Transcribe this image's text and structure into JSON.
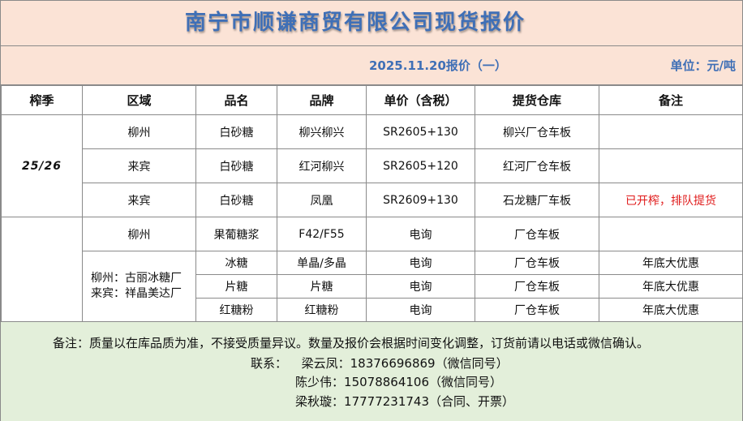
{
  "header": {
    "title": "南宁市顺谦商贸有限公司现货报价",
    "date_label": "2025.11.20报价（一）",
    "unit_label": "单位：元/吨"
  },
  "table": {
    "columns": [
      "榨季",
      "区域",
      "品名",
      "品牌",
      "单价（含税）",
      "提货仓库",
      "备注"
    ],
    "season": "25/26",
    "rows": [
      {
        "region": "柳州",
        "product": "白砂糖",
        "brand": "柳兴柳兴",
        "price": "SR2605+130",
        "warehouse": "柳兴厂仓车板",
        "remark": ""
      },
      {
        "region": "来宾",
        "product": "白砂糖",
        "brand": "红河柳兴",
        "price": "SR2605+120",
        "warehouse": "红河厂仓车板",
        "remark": ""
      },
      {
        "region": "来宾",
        "product": "白砂糖",
        "brand": "凤凰",
        "price": "SR2609+130",
        "warehouse": "石龙糖厂车板",
        "remark": "已开榨，排队提货"
      },
      {
        "region": "柳州",
        "product": "果葡糖浆",
        "brand": "F42/F55",
        "price": "电询",
        "warehouse": "厂仓车板",
        "remark": ""
      },
      {
        "region": "",
        "product": "冰糖",
        "brand": "单晶/多晶",
        "price": "电询",
        "warehouse": "厂仓车板",
        "remark": "年底大优惠"
      },
      {
        "region": "",
        "product": "片糖",
        "brand": "片糖",
        "price": "电询",
        "warehouse": "厂仓车板",
        "remark": "年底大优惠"
      },
      {
        "region": "",
        "product": "红糖粉",
        "brand": "红糖粉",
        "price": "电询",
        "warehouse": "厂仓车板",
        "remark": "年底大优惠"
      }
    ],
    "factory_line1": "柳州：古丽冰糖厂",
    "factory_line2": "来宾：祥晶美达厂"
  },
  "footer": {
    "note": "备注：质量以在库品质为准，不接受质量异议。数量及报价会根据时间变化调整，订货前请以电话或微信确认。",
    "contact_label": "联系：",
    "contacts": [
      {
        "name": "梁云凤",
        "phone": "18376696869",
        "memo": "（微信同号）"
      },
      {
        "name": "陈少伟",
        "phone": "15078864106",
        "memo": "（微信同号）"
      },
      {
        "name": "梁秋璇",
        "phone": "17777231743",
        "memo": "（合同、开票）"
      }
    ]
  },
  "colors": {
    "header_bg": "#fbe3d6",
    "title_blue": "#3f6fb6",
    "footer_bg": "#e3efda",
    "remark_red": "#e01b1b"
  }
}
